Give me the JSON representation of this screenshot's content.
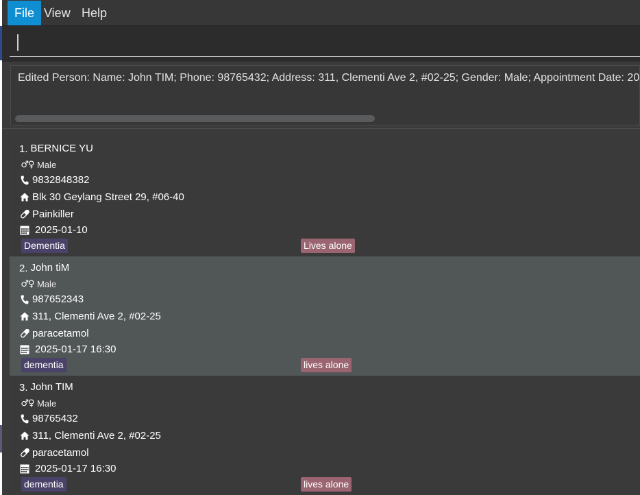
{
  "menu": {
    "file": "File",
    "view": "View",
    "help": "Help"
  },
  "command": {
    "value": ""
  },
  "result": {
    "text": "Edited Person: Name: John TIM; Phone: 98765432; Address: 311, Clementi Ave 2, #02-25; Gender: Male; Appointment Date: 20"
  },
  "colors": {
    "accent": "#0f8fd2",
    "condition_tag": "#4a4268",
    "living_tag": "#9a6470"
  },
  "persons": [
    {
      "index": "1.",
      "name": "BERNICE YU",
      "gender": "Male",
      "phone": "9832848382",
      "address": "Blk 30 Geylang Street 29, #06-40",
      "medication": "Painkiller",
      "appointment": "2025-01-10",
      "tags": [
        "Dementia",
        "Lives alone"
      ]
    },
    {
      "index": "2.",
      "name": "John tiM",
      "gender": "Male",
      "phone": "987652343",
      "address": "311, Clementi Ave 2, #02-25",
      "medication": "paracetamol",
      "appointment": "2025-01-17 16:30",
      "tags": [
        "dementia",
        "lives alone"
      ]
    },
    {
      "index": "3.",
      "name": "John TIM",
      "gender": "Male",
      "phone": "98765432",
      "address": "311, Clementi Ave 2, #02-25",
      "medication": "paracetamol",
      "appointment": "2025-01-17 16:30",
      "tags": [
        "dementia",
        "lives alone"
      ]
    }
  ]
}
